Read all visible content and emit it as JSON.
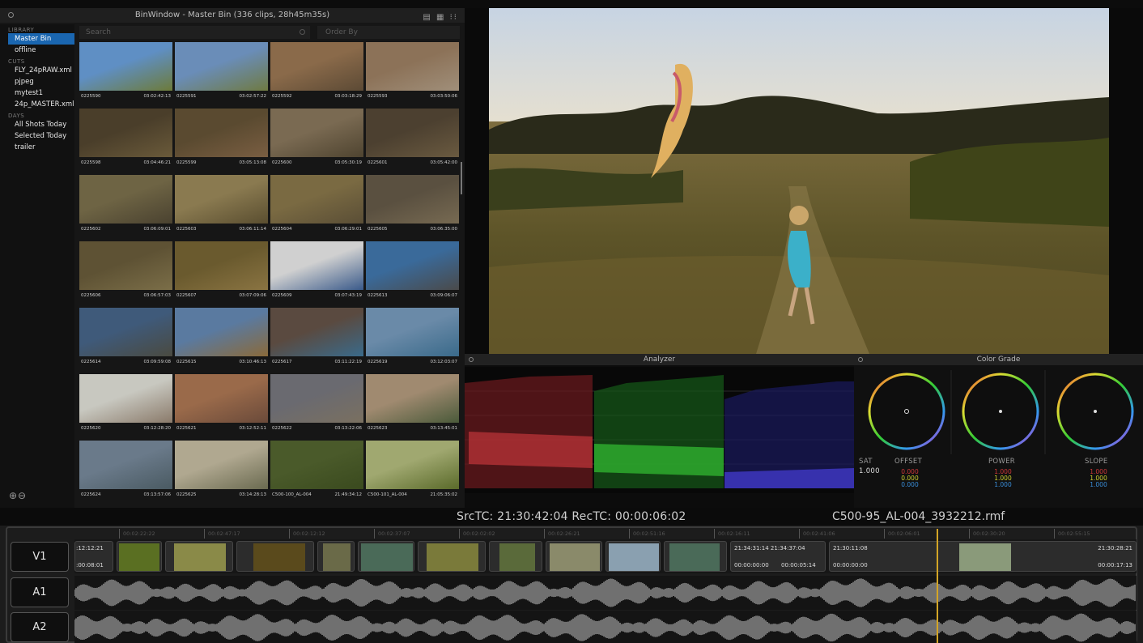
{
  "bin": {
    "title": "BinWindow - Master Bin (336 clips, 28h45m35s)",
    "view_icons": "▤ ▦ ⁝⁝",
    "search_placeholder": "Search",
    "order_placeholder": "Order By",
    "library_heading": "LIBRARY",
    "library_items": [
      "Master Bin",
      "offline"
    ],
    "cuts_heading": "CUTS",
    "cuts_items": [
      "FLY_24pRAW.xml",
      "pjpeg",
      "mytest1",
      "24p_MASTER.xml"
    ],
    "days_heading": "DAYS",
    "days_items": [
      "All Shots Today",
      "Selected Today",
      "trailer"
    ],
    "add_remove": "⊕⊖",
    "clips": [
      {
        "name": "0225590",
        "tc": "03:02:42:13"
      },
      {
        "name": "0225591",
        "tc": "03:02:57:22"
      },
      {
        "name": "0225592",
        "tc": "03:03:18:29"
      },
      {
        "name": "0225593",
        "tc": "03:03:50:06"
      },
      {
        "name": "0225598",
        "tc": "03:04:46:21"
      },
      {
        "name": "0225599",
        "tc": "03:05:13:08"
      },
      {
        "name": "0225600",
        "tc": "03:05:30:19"
      },
      {
        "name": "0225601",
        "tc": "03:05:42:00"
      },
      {
        "name": "0225602",
        "tc": "03:06:09:01"
      },
      {
        "name": "0225603",
        "tc": "03:06:11:14"
      },
      {
        "name": "0225604",
        "tc": "03:06:29:01"
      },
      {
        "name": "0225605",
        "tc": "03:06:35:00"
      },
      {
        "name": "0225606",
        "tc": "03:06:57:03"
      },
      {
        "name": "0225607",
        "tc": "03:07:09:06"
      },
      {
        "name": "0225609",
        "tc": "03:07:43:19"
      },
      {
        "name": "0225613",
        "tc": "03:09:06:07"
      },
      {
        "name": "0225614",
        "tc": "03:09:59:08"
      },
      {
        "name": "0225615",
        "tc": "03:10:46:13"
      },
      {
        "name": "0225617",
        "tc": "03:11:22:19"
      },
      {
        "name": "0225619",
        "tc": "03:12:03:07"
      },
      {
        "name": "0225620",
        "tc": "03:12:28:20"
      },
      {
        "name": "0225621",
        "tc": "03:12:52:11"
      },
      {
        "name": "0225622",
        "tc": "03:13:22:06"
      },
      {
        "name": "0225623",
        "tc": "03:13:45:01"
      },
      {
        "name": "0225624",
        "tc": "03:13:57:06"
      },
      {
        "name": "0225625",
        "tc": "03:14:28:13"
      },
      {
        "name": "C500-100_AL-004",
        "tc": "21:49:34:12"
      },
      {
        "name": "C500-101_AL-004",
        "tc": "21:05:35:02"
      }
    ]
  },
  "analyzer": {
    "title": "Analyzer"
  },
  "grade": {
    "title": "Color Grade",
    "sat_label": "SAT",
    "sat_value": "1.000",
    "labels": [
      "OFFSET",
      "POWER",
      "SLOPE"
    ],
    "values": [
      {
        "r": "0.000",
        "g": "0.000",
        "b": "0.000"
      },
      {
        "r": "1.000",
        "g": "1.000",
        "b": "1.000"
      },
      {
        "r": "1.000",
        "g": "1.000",
        "b": "1.000"
      }
    ]
  },
  "timeline": {
    "tc_display": "SrcTC: 21:30:42:04  RecTC: 00:00:06:02",
    "clip_name": "C500-95_AL-004_3932212.rmf",
    "tracks": [
      "V1",
      "A1",
      "A2"
    ],
    "ruler": [
      "00:02:22:22",
      "00:02:47:17",
      "00:02:12:12",
      "00:02:37:07",
      "00:02:02:02",
      "00:02:26:21",
      "00:02:51:16",
      "00:02:16:11",
      "00:02:41:06",
      "00:02:06:01",
      "00:02:30:20",
      "00:02:55:15"
    ],
    "v1_first_tc": ":12:12:21",
    "v1_first_dur": ":00:08:01",
    "v1_mid_tc": "21:34:31:14  21:34:37:04",
    "v1_mid_in": "00:00:00:00",
    "v1_mid_dur": "00:00:05:14",
    "v1_next_tc": "21:30:11:08",
    "v1_next_in": "00:00:00:00",
    "v1_last_tc": "21:30:28:21",
    "v1_last_dur": "00:00:17:13"
  }
}
